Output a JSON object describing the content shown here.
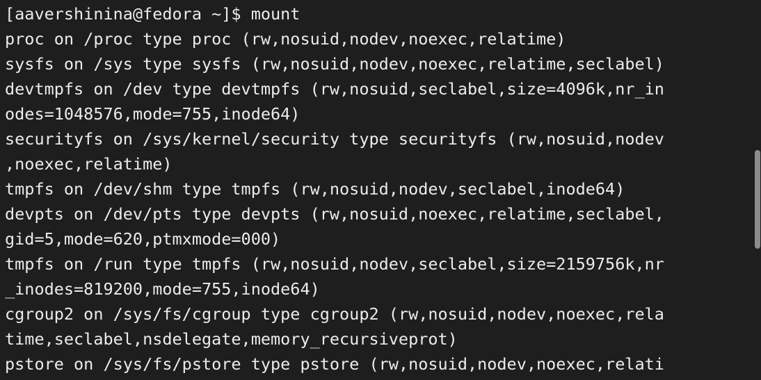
{
  "terminal": {
    "lines": [
      "[aavershinina@fedora ~]$ mount",
      "proc on /proc type proc (rw,nosuid,nodev,noexec,relatime)",
      "sysfs on /sys type sysfs (rw,nosuid,nodev,noexec,relatime,seclabel)",
      "devtmpfs on /dev type devtmpfs (rw,nosuid,seclabel,size=4096k,nr_in",
      "odes=1048576,mode=755,inode64)",
      "securityfs on /sys/kernel/security type securityfs (rw,nosuid,nodev",
      ",noexec,relatime)",
      "tmpfs on /dev/shm type tmpfs (rw,nosuid,nodev,seclabel,inode64)",
      "devpts on /dev/pts type devpts (rw,nosuid,noexec,relatime,seclabel,",
      "gid=5,mode=620,ptmxmode=000)",
      "tmpfs on /run type tmpfs (rw,nosuid,nodev,seclabel,size=2159756k,nr",
      "_inodes=819200,mode=755,inode64)",
      "cgroup2 on /sys/fs/cgroup type cgroup2 (rw,nosuid,nodev,noexec,rela",
      "time,seclabel,nsdelegate,memory_recursiveprot)",
      "pstore on /sys/fs/pstore type pstore (rw,nosuid,nodev,noexec,relati"
    ]
  },
  "colors": {
    "background": "#1e1e1e",
    "text": "#ececec",
    "scrollbar_thumb": "#8c8c8c"
  }
}
